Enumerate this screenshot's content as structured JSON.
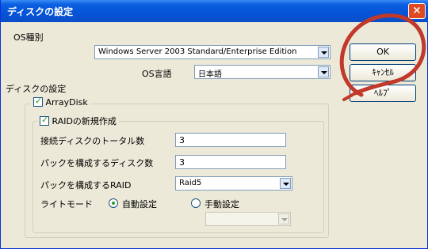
{
  "window": {
    "title": "ディスクの設定",
    "close_glyph": "×"
  },
  "os_type": {
    "label": "OS種別",
    "value": "Windows Server 2003 Standard/Enterprise Edition"
  },
  "os_language": {
    "label": "OS言語",
    "value": "日本語"
  },
  "buttons": {
    "ok": "OK",
    "cancel": "ｷｬﾝｾﾙ",
    "help": "ﾍﾙﾌﾟ"
  },
  "disk_settings": {
    "section_label": "ディスクの設定",
    "arraydisk": {
      "label": "ArrayDisk",
      "checked": true
    },
    "new_raid": {
      "label": "RAIDの新規作成",
      "checked": true
    },
    "disk_count": {
      "label": "接続ディスクのトータル数",
      "value": "3"
    },
    "pack_disk_count": {
      "label": "パックを構成するディスク数",
      "value": "3"
    },
    "raid_level": {
      "label": "パックを構成するRAID",
      "value": "Raid5"
    },
    "write_mode": {
      "label": "ライトモード",
      "auto": "自動設定",
      "manual": "手動設定",
      "selected": "auto",
      "manual_value": ""
    }
  },
  "annotation_color": "#c0392b"
}
